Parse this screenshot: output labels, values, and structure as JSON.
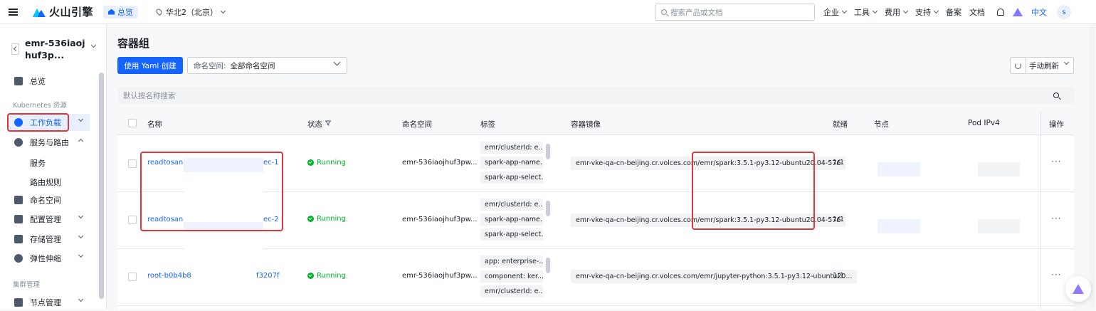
{
  "topbar": {
    "brand": "火山引擎",
    "overview": "总览",
    "region": "华北2（北京）",
    "search_placeholder": "搜索产品或文档",
    "nav": [
      "企业",
      "工具",
      "费用",
      "支持",
      "备案",
      "文档"
    ],
    "language": "中文",
    "avatar": "s"
  },
  "sidebar": {
    "cluster_name": "emr-536iaojhuf3p...",
    "overview": "总览",
    "group_k8s": "Kubernetes 资源",
    "workload": "工作负载",
    "service_route": "服务与路由",
    "service": "服务",
    "route_rule": "路由规则",
    "namespace": "命名空间",
    "config": "配置管理",
    "storage": "存储管理",
    "autoscale": "弹性伸缩",
    "group_cluster": "集群管理",
    "node_mgmt": "节点管理"
  },
  "main": {
    "title": "容器组",
    "create_button": "使用 Yaml 创建",
    "namespace_label": "命名空间:",
    "namespace_value": "全部命名空间",
    "refresh_mode": "手动刷新",
    "search_placeholder": "默认按名称搜索"
  },
  "table": {
    "headers": {
      "name": "名称",
      "status": "状态",
      "namespace": "命名空间",
      "labels": "标签",
      "image": "容器镜像",
      "ready": "就绪",
      "node": "节点",
      "pod_ip": "Pod IPv4",
      "ops": "操作"
    },
    "rows": [
      {
        "name_prefix": "readtosandc",
        "name_suffix": "ec-1",
        "status": "Running",
        "namespace": "emr-536iaojhuf3pw...",
        "labels": [
          "emr/clusterId: e...",
          "spark-app-name...",
          "spark-app-select..."
        ],
        "image": "emr-vke-qa-cn-beijing.cr.volces.com/emr/spark:3.5.1-py3.12-ubuntu20.04-576",
        "ready": "1/1",
        "ops": "···"
      },
      {
        "name_prefix": "readtosandc",
        "name_suffix": "ec-2",
        "status": "Running",
        "namespace": "emr-536iaojhuf3pw...",
        "labels": [
          "emr/clusterId: e...",
          "spark-app-name...",
          "spark-app-select..."
        ],
        "image": "emr-vke-qa-cn-beijing.cr.volces.com/emr/spark:3.5.1-py3.12-ubuntu20.04-576",
        "ready": "1/1",
        "ops": "···"
      },
      {
        "name_prefix": "root-b0b4b8",
        "name_suffix": "f3207f",
        "status": "Running",
        "namespace": "emr-536iaojhuf3pw...",
        "labels": [
          "app: enterprise-...",
          "component: ker...",
          "emr/clusterId: e..."
        ],
        "image": "emr-vke-qa-cn-beijing.cr.volces.com/emr/jupyter-python:3.5.1-py3.12-ubuntu20...",
        "ready": "1/1",
        "ops": "···"
      }
    ]
  }
}
